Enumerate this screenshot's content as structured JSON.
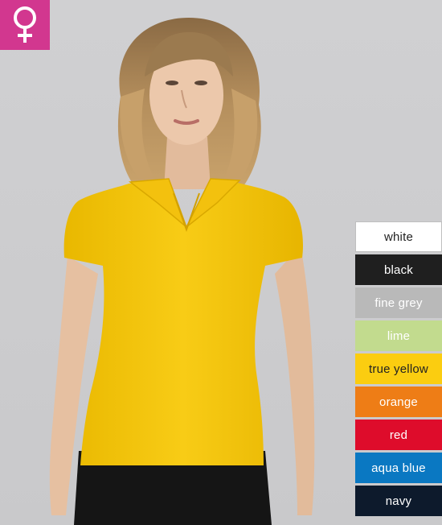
{
  "badge": {
    "icon": "female-symbol-icon",
    "background": "#d2378f",
    "icon_color": "#ffffff"
  },
  "product_photo": {
    "shirt_color": "#f7c70f"
  },
  "swatches": [
    {
      "label": "white",
      "color": "#ffffff",
      "text_color": "#222222"
    },
    {
      "label": "black",
      "color": "#1f1f1f",
      "text_color": "#ffffff"
    },
    {
      "label": "fine grey",
      "color": "#b9b9b9",
      "text_color": "#ffffff"
    },
    {
      "label": "lime",
      "color": "#c2db8e",
      "text_color": "#ffffff"
    },
    {
      "label": "true yellow",
      "color": "#fbcd10",
      "text_color": "#222222"
    },
    {
      "label": "orange",
      "color": "#ee7d16",
      "text_color": "#ffffff"
    },
    {
      "label": "red",
      "color": "#de0c2b",
      "text_color": "#ffffff"
    },
    {
      "label": "aqua blue",
      "color": "#0a78c2",
      "text_color": "#ffffff"
    },
    {
      "label": "navy",
      "color": "#0d1a2c",
      "text_color": "#ffffff"
    }
  ]
}
